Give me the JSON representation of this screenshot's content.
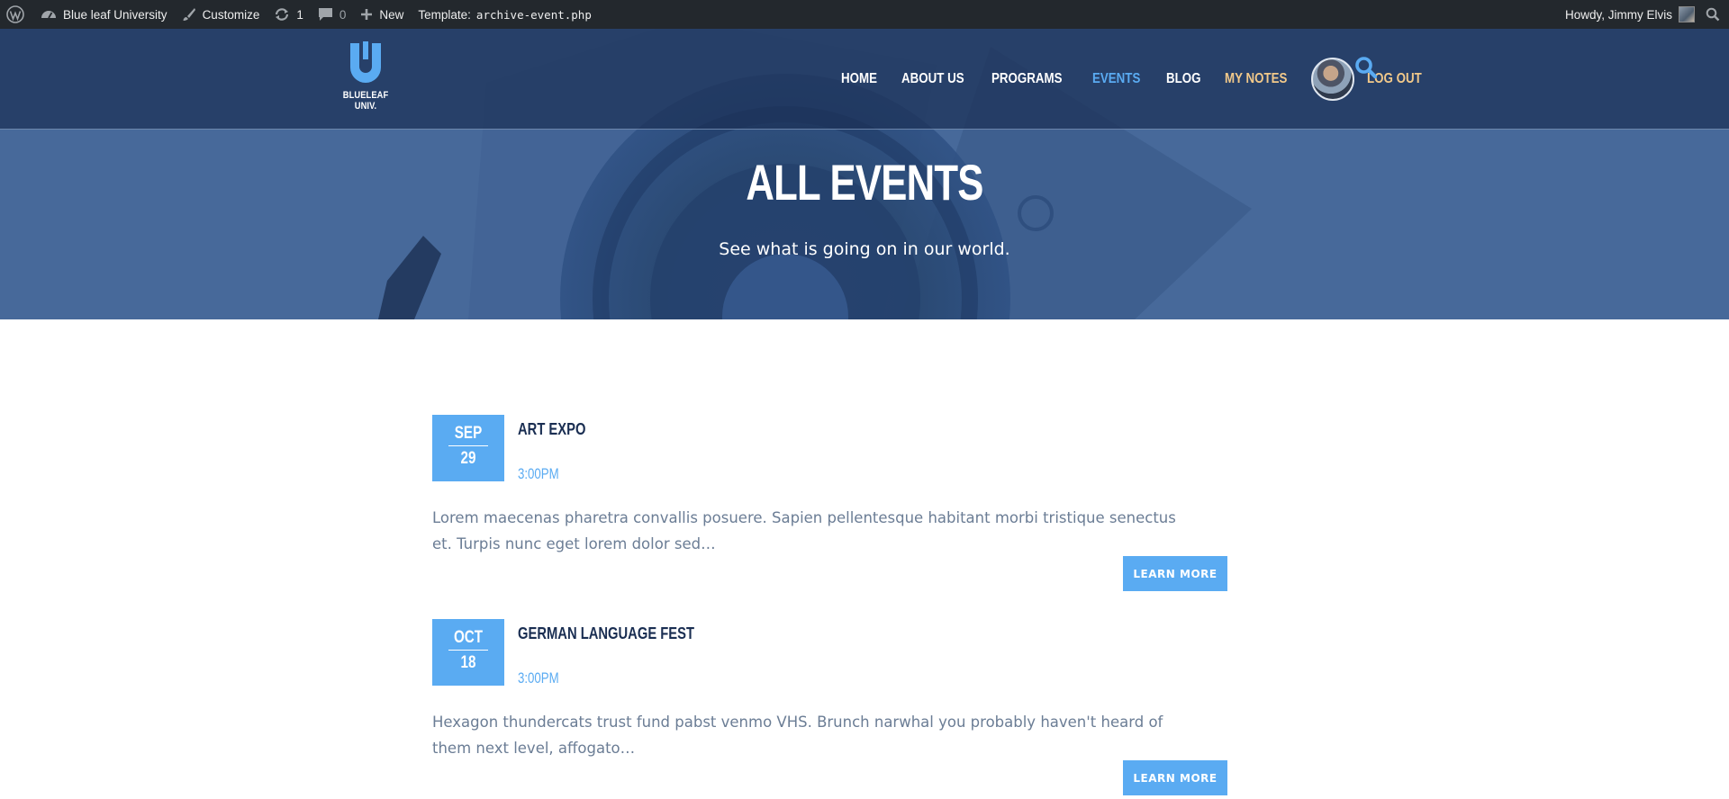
{
  "admin_bar": {
    "site_name": "Blue leaf University",
    "customize": "Customize",
    "updates_count": "1",
    "comments_count": "0",
    "new_label": "New",
    "template_label": "Template:",
    "template_file": "archive-event.php",
    "greeting": "Howdy, Jimmy Elvis",
    "icons": [
      "wordpress-icon",
      "dashboard-icon",
      "brush-icon",
      "updates-icon",
      "comment-icon",
      "plus-icon",
      "search-icon"
    ]
  },
  "header": {
    "logo_text": "BLUELEAF UNIV.",
    "nav": {
      "home": "HOME",
      "about": "ABOUT US",
      "programs": "PROGRAMS",
      "events": "EVENTS",
      "blog": "BLOG",
      "notes": "MY NOTES",
      "logout": "LOG OUT"
    },
    "active_item": "EVENTS"
  },
  "hero": {
    "title": "ALL EVENTS",
    "subtitle": "See what is going on in our world."
  },
  "events": [
    {
      "month": "SEP",
      "day": "29",
      "title": "ART EXPO",
      "time": "3:00PM",
      "excerpt": "Lorem maecenas pharetra convallis posuere. Sapien pellentesque habitant morbi tristique senectus et. Turpis nunc eget lorem dolor sed…",
      "button": "LEARN MORE"
    },
    {
      "month": "OCT",
      "day": "18",
      "title": "GERMAN LANGUAGE FEST",
      "time": "3:00PM",
      "excerpt": "Hexagon thundercats trust fund pabst venmo VHS. Brunch narwhal you probably haven't heard of them next level, affogato…",
      "button": "LEARN MORE"
    }
  ],
  "colors": {
    "accent": "#5aabf2",
    "notes_accent": "#f2c98a",
    "title_dark": "#1a2e52",
    "admin_bar": "#23282d"
  }
}
